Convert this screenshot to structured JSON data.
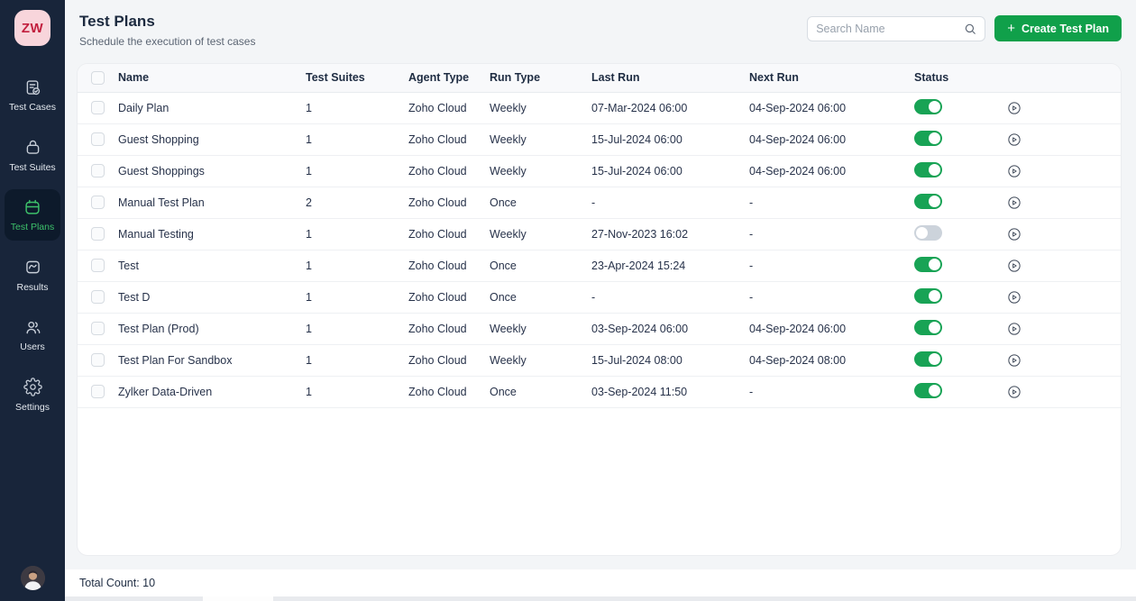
{
  "app": {
    "logo_text": "ZW"
  },
  "sidebar": {
    "items": [
      {
        "label": "Test Cases"
      },
      {
        "label": "Test Suites"
      },
      {
        "label": "Test Plans"
      },
      {
        "label": "Results"
      },
      {
        "label": "Users"
      },
      {
        "label": "Settings"
      }
    ],
    "active_item": "Test Plans"
  },
  "header": {
    "title": "Test Plans",
    "subtitle": "Schedule the execution of test cases",
    "search_placeholder": "Search Name",
    "create_plus": "+",
    "create_label": "Create Test Plan"
  },
  "table": {
    "columns": [
      "Name",
      "Test Suites",
      "Agent Type",
      "Run Type",
      "Last Run",
      "Next Run",
      "Status"
    ],
    "rows": [
      {
        "name": "Daily Plan",
        "suites": "1",
        "agent": "Zoho Cloud",
        "run": "Weekly",
        "last": "07-Mar-2024 06:00",
        "next": "04-Sep-2024 06:00",
        "status": "on"
      },
      {
        "name": "Guest Shopping",
        "suites": "1",
        "agent": "Zoho Cloud",
        "run": "Weekly",
        "last": "15-Jul-2024 06:00",
        "next": "04-Sep-2024 06:00",
        "status": "on"
      },
      {
        "name": "Guest Shoppings",
        "suites": "1",
        "agent": "Zoho Cloud",
        "run": "Weekly",
        "last": "15-Jul-2024 06:00",
        "next": "04-Sep-2024 06:00",
        "status": "on"
      },
      {
        "name": "Manual Test Plan",
        "suites": "2",
        "agent": "Zoho Cloud",
        "run": "Once",
        "last": "-",
        "next": "-",
        "status": "on"
      },
      {
        "name": "Manual Testing",
        "suites": "1",
        "agent": "Zoho Cloud",
        "run": "Weekly",
        "last": "27-Nov-2023 16:02",
        "next": "-",
        "status": "off"
      },
      {
        "name": "Test",
        "suites": "1",
        "agent": "Zoho Cloud",
        "run": "Once",
        "last": "23-Apr-2024 15:24",
        "next": "-",
        "status": "on"
      },
      {
        "name": "Test D",
        "suites": "1",
        "agent": "Zoho Cloud",
        "run": "Once",
        "last": "-",
        "next": "-",
        "status": "on"
      },
      {
        "name": "Test Plan (Prod)",
        "suites": "1",
        "agent": "Zoho Cloud",
        "run": "Weekly",
        "last": "03-Sep-2024 06:00",
        "next": "04-Sep-2024 06:00",
        "status": "on"
      },
      {
        "name": "Test Plan For Sandbox",
        "suites": "1",
        "agent": "Zoho Cloud",
        "run": "Weekly",
        "last": "15-Jul-2024 08:00",
        "next": "04-Sep-2024 08:00",
        "status": "on"
      },
      {
        "name": "Zylker Data-Driven",
        "suites": "1",
        "agent": "Zoho Cloud",
        "run": "Once",
        "last": "03-Sep-2024 11:50",
        "next": "-",
        "status": "on"
      }
    ]
  },
  "footer": {
    "total_count": "Total Count: 10"
  },
  "colors": {
    "sidebar_bg": "#18253a",
    "active_green": "#3dc06a",
    "button_green": "#10a04a",
    "toggle_on": "#18a355",
    "toggle_off": "#ccd3db",
    "logo_bg": "#f8d5db",
    "logo_text": "#c21f3e"
  }
}
